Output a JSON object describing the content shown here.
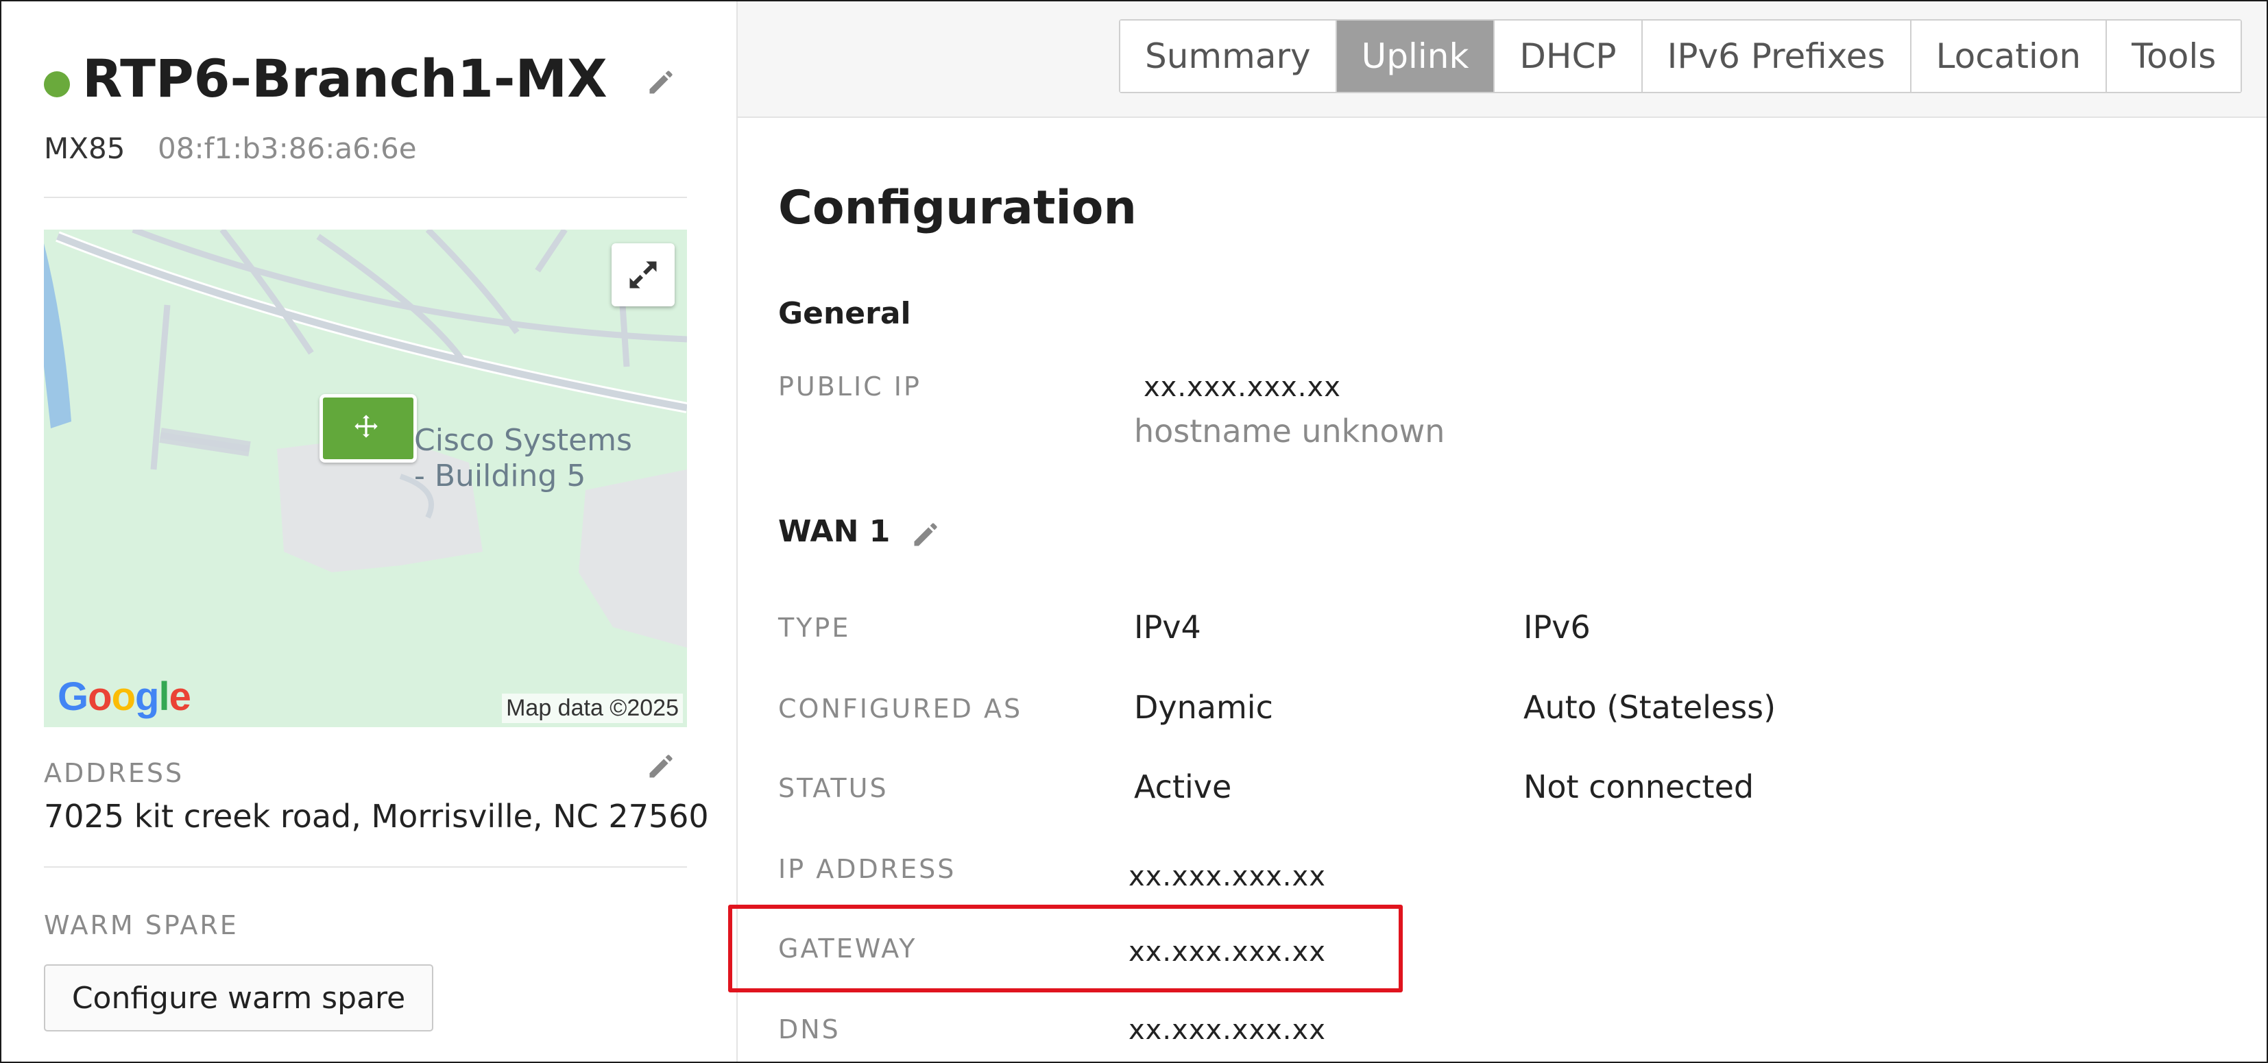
{
  "device": {
    "name": "RTP6-Branch1-MX",
    "model": "MX85",
    "mac": "08:f1:b3:86:a6:6e",
    "status_color": "#6aaa3c"
  },
  "map": {
    "place_label_line1": "Cisco Systems",
    "place_label_line2": "- Building 5",
    "provider_logo": "Google",
    "attribution": "Map data ©2025",
    "expand_icon": "expand-arrows-icon",
    "marker_icon": "move-arrows-icon"
  },
  "address": {
    "label": "ADDRESS",
    "value": "7025 kit creek road, Morrisville, NC 27560"
  },
  "warm_spare": {
    "label": "WARM SPARE",
    "button_label": "Configure warm spare"
  },
  "tabs": [
    {
      "label": "Summary",
      "active": false
    },
    {
      "label": "Uplink",
      "active": true
    },
    {
      "label": "DHCP",
      "active": false
    },
    {
      "label": "IPv6 Prefixes",
      "active": false
    },
    {
      "label": "Location",
      "active": false
    },
    {
      "label": "Tools",
      "active": false
    }
  ],
  "configuration": {
    "title": "Configuration",
    "general": {
      "title": "General",
      "public_ip_label": "PUBLIC IP",
      "public_ip_value": "xx.xxx.xxx.xx",
      "hostname": "hostname unknown"
    },
    "wan1": {
      "title": "WAN 1",
      "type_label": "TYPE",
      "type_ipv4": "IPv4",
      "type_ipv6": "IPv6",
      "configured_as_label": "CONFIGURED AS",
      "configured_as_ipv4": "Dynamic",
      "configured_as_ipv6": "Auto (Stateless)",
      "status_label": "STATUS",
      "status_ipv4": "Active",
      "status_ipv6": "Not connected",
      "ip_address_label": "IP ADDRESS",
      "ip_address_value": "xx.xxx.xxx.xx",
      "gateway_label": "GATEWAY",
      "gateway_value": "xx.xxx.xxx.xx",
      "dns_label": "DNS",
      "dns_value": "xx.xxx.xxx.xx"
    }
  },
  "colors": {
    "accent_green": "#6aaa3c",
    "highlight_red": "#e0141e",
    "active_tab": "#9e9e9e"
  }
}
